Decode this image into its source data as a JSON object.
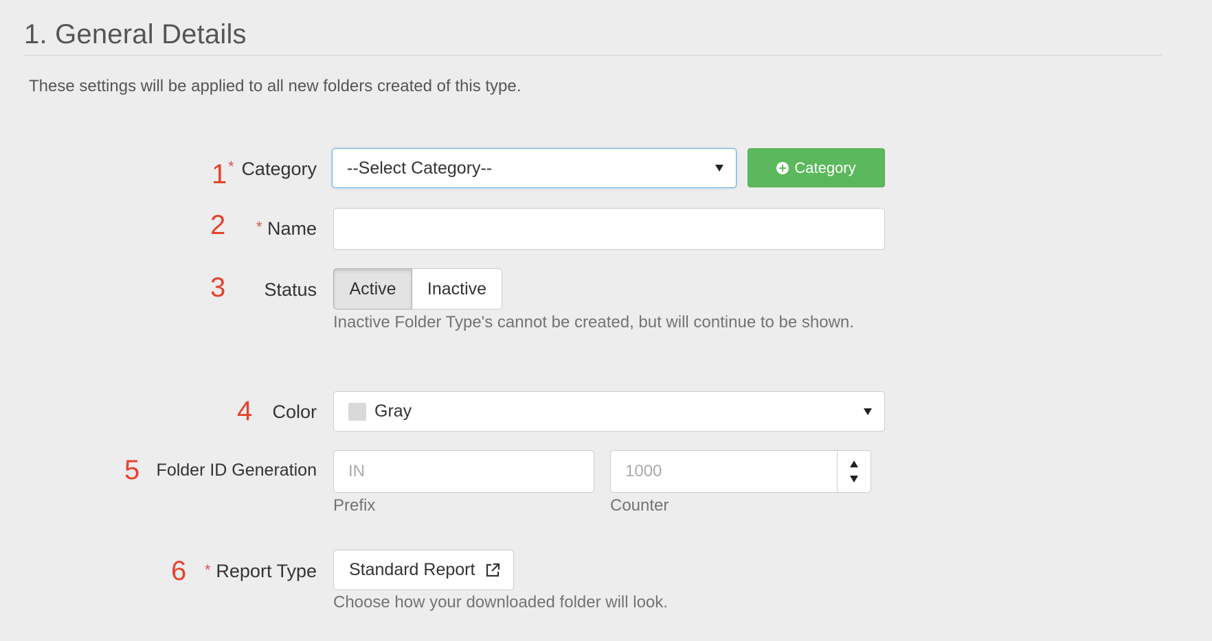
{
  "section": {
    "title": "1. General Details",
    "intro": "These settings will be applied to all new folders created of this type."
  },
  "required_marker": "*",
  "fields": {
    "category": {
      "number": "1",
      "label": "Category",
      "selected": "--Select Category--",
      "add_button": "Category"
    },
    "name": {
      "number": "2",
      "label": "Name",
      "value": ""
    },
    "status": {
      "number": "3",
      "label": "Status",
      "options": [
        "Active",
        "Inactive"
      ],
      "selected": "Active",
      "help": "Inactive Folder Type's cannot be created, but will continue to be shown."
    },
    "color": {
      "number": "4",
      "label": "Color",
      "selected": "Gray",
      "swatch_color": "#d9d9d9"
    },
    "folder_id": {
      "number": "5",
      "label": "Folder ID Generation",
      "prefix_placeholder": "IN",
      "prefix_caption": "Prefix",
      "counter_placeholder": "1000",
      "counter_caption": "Counter"
    },
    "report_type": {
      "number": "6",
      "label": "Report Type",
      "button": "Standard Report",
      "help": "Choose how your downloaded folder will look."
    }
  },
  "colors": {
    "accent_green": "#5cb85c",
    "number_red": "#e8412c",
    "required_red": "#d9534f"
  }
}
